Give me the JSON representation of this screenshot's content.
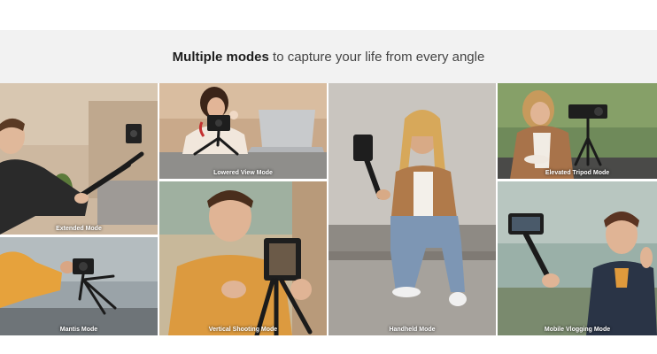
{
  "header": {
    "headline_strong": "Multiple modes",
    "headline_rest": " to capture your life from every angle"
  },
  "modes": {
    "extended": "Extended Mode",
    "mantis": "Mantis Mode",
    "lowered": "Lowered View Mode",
    "vertical": "Vertical Shooting Mode",
    "handheld": "Handheld Mode",
    "elevated": "Elevated Tripod Mode",
    "vlogging": "Mobile Vlogging Mode"
  },
  "colors": {
    "header_bg": "#f2f2f2",
    "caption": "#ffffff"
  }
}
